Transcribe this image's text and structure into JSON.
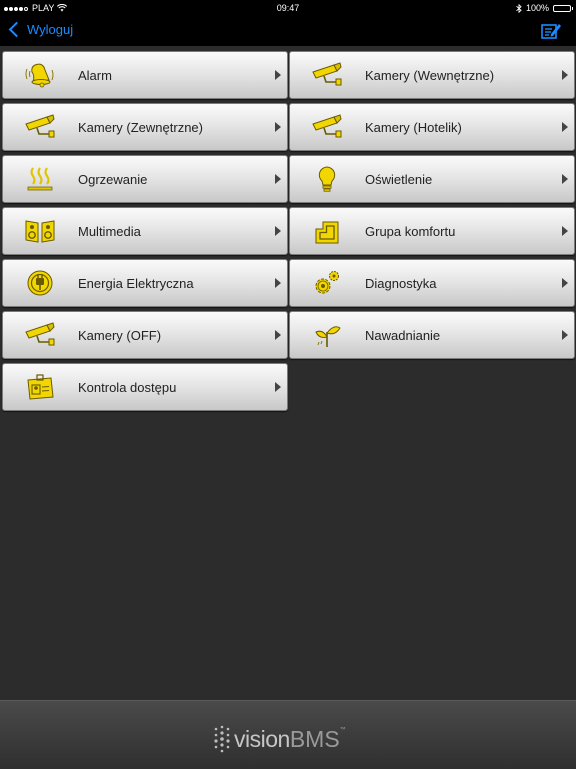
{
  "status_bar": {
    "carrier": "PLAY",
    "time": "09:47",
    "battery": "100%",
    "battery_level": 1.0
  },
  "nav": {
    "back_label": "Wyloguj",
    "edit_icon": "edit-list-icon"
  },
  "menu": {
    "left": [
      {
        "label": "Alarm",
        "icon": "alarm-bell-icon"
      },
      {
        "label": "Kamery (Zewnętrzne)",
        "icon": "camera-icon"
      },
      {
        "label": "Ogrzewanie",
        "icon": "heating-icon"
      },
      {
        "label": "Multimedia",
        "icon": "speakers-icon"
      },
      {
        "label": "Energia Elektryczna",
        "icon": "power-plug-icon"
      },
      {
        "label": "Kamery (OFF)",
        "icon": "camera-icon"
      },
      {
        "label": "Kontrola dostępu",
        "icon": "id-card-icon"
      }
    ],
    "right": [
      {
        "label": "Kamery (Wewnętrzne)",
        "icon": "camera-icon"
      },
      {
        "label": "Kamery (Hotelik)",
        "icon": "camera-icon"
      },
      {
        "label": "Oświetlenie",
        "icon": "light-bulb-icon"
      },
      {
        "label": "Grupa komfortu",
        "icon": "comfort-group-icon"
      },
      {
        "label": "Diagnostyka",
        "icon": "gears-icon"
      },
      {
        "label": "Nawadnianie",
        "icon": "sprout-icon"
      }
    ]
  },
  "footer": {
    "brand_vision": "vision",
    "brand_bms": "BMS",
    "brand_tm": "™"
  },
  "colors": {
    "accent": "#1a8cff",
    "icon_yellow": "#f2d600",
    "background": "#2c2c2c"
  }
}
